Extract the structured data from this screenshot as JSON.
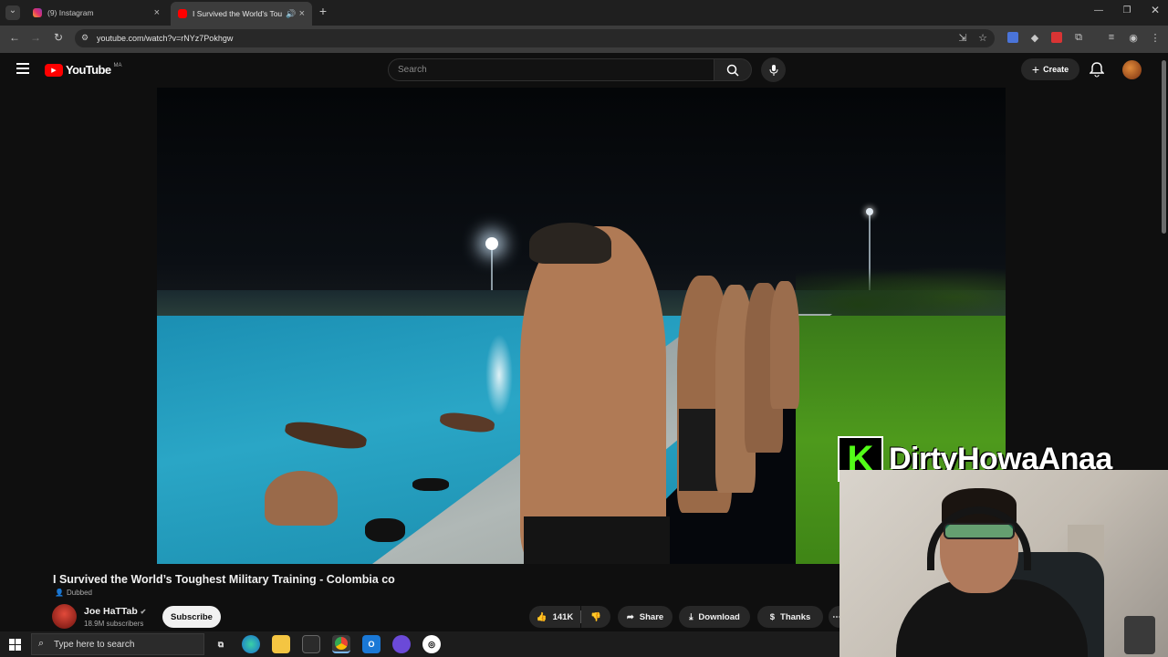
{
  "browser": {
    "tabs": [
      {
        "title": "(9) Instagram",
        "active": false,
        "icon": "instagram-icon"
      },
      {
        "title": "I Survived the World's Toug",
        "active": true,
        "icon": "youtube-icon"
      }
    ],
    "url": "youtube.com/watch?v=rNYz7Pokhgw"
  },
  "youtube": {
    "logo_text": "YouTube",
    "region": "MA",
    "search_placeholder": "Search",
    "create_label": "Create"
  },
  "video": {
    "title": "I Survived the World’s Toughest Military Training - Colombia co",
    "dubbed_label": "Dubbed",
    "channel": {
      "name": "Joe HaTTab",
      "subscribers": "18.9M subscribers",
      "verified": true
    },
    "subscribe_label": "Subscribe",
    "actions": {
      "likes": "141K",
      "share": "Share",
      "download": "Download",
      "thanks": "Thanks"
    }
  },
  "overlay": {
    "logo_letter": "K",
    "streamer_name": "DirtyHowaAnaa",
    "accent_color": "#53fc18"
  },
  "taskbar": {
    "search_placeholder": "Type here to search"
  },
  "colors": {
    "youtube_red": "#ff0000",
    "background": "#0f0f0f",
    "chrome_bg": "#3c3c3c"
  }
}
